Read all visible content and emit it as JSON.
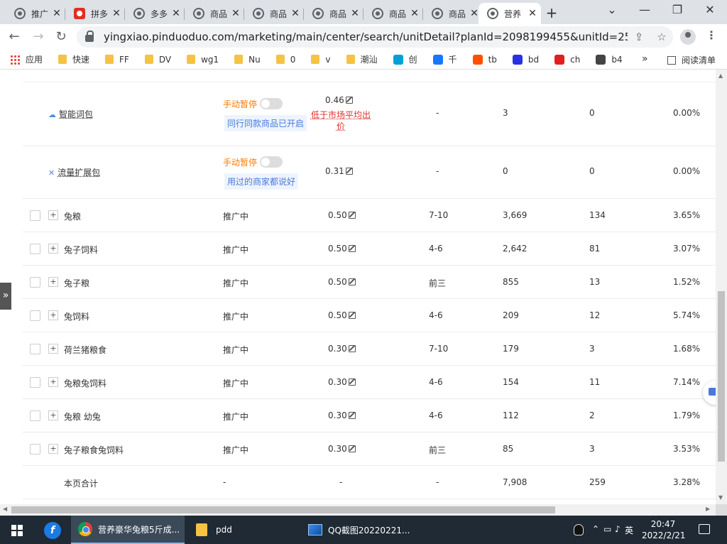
{
  "browser": {
    "tabs": [
      {
        "label": "推广",
        "type": "globe"
      },
      {
        "label": "拼多",
        "type": "pdd"
      },
      {
        "label": "多多",
        "type": "globe"
      },
      {
        "label": "商品",
        "type": "globe"
      },
      {
        "label": "商品",
        "type": "globe"
      },
      {
        "label": "商品",
        "type": "globe"
      },
      {
        "label": "商品",
        "type": "globe"
      },
      {
        "label": "商品",
        "type": "globe"
      },
      {
        "label": "营养",
        "type": "globe",
        "active": true
      }
    ],
    "url": "yingxiao.pinduoduo.com/marketing/main/center/search/unitDetail?planId=2098199455&unitId=257494901...",
    "bookmarks": [
      {
        "label": "应用",
        "icon": "apps-grid-icon"
      },
      {
        "label": "快速",
        "icon": "folder-icon"
      },
      {
        "label": "FF",
        "icon": "folder-icon"
      },
      {
        "label": "DV",
        "icon": "folder-icon"
      },
      {
        "label": "wg1",
        "icon": "folder-icon"
      },
      {
        "label": "Nu",
        "icon": "folder-icon"
      },
      {
        "label": "0",
        "icon": "folder-icon"
      },
      {
        "label": "v",
        "icon": "folder-icon"
      },
      {
        "label": "潮汕",
        "icon": "folder-icon"
      },
      {
        "label": "创",
        "icon": "bilibili-icon",
        "color": "#00a1d6"
      },
      {
        "label": "千",
        "icon": "qianniu-icon",
        "color": "#1677ff"
      },
      {
        "label": "tb",
        "icon": "taobao-icon",
        "color": "#ff5000"
      },
      {
        "label": "bd",
        "icon": "baidu-icon",
        "color": "#2932e1"
      },
      {
        "label": "ch",
        "icon": "ch-icon",
        "color": "#e02020"
      },
      {
        "label": "b4",
        "icon": "b4-icon",
        "color": "#444"
      }
    ],
    "reading_list": "阅读清单"
  },
  "packages": [
    {
      "icon": "cloud-icon",
      "name": "智能词包",
      "status": "手动暂停",
      "tag": "同行同款商品已开启",
      "bid": "0.46",
      "warning": "低于市场平均出价",
      "rank": "-",
      "impressions": "3",
      "clicks": "0",
      "ctr": "0.00%"
    },
    {
      "icon": "expand-icon",
      "name": "流量扩展包",
      "status": "手动暂停",
      "tag": "用过的商家都说好",
      "bid": "0.31",
      "warning": "",
      "rank": "-",
      "impressions": "0",
      "clicks": "0",
      "ctr": "0.00%"
    }
  ],
  "keywords": [
    {
      "name": "兔粮",
      "status": "推广中",
      "bid": "0.50",
      "rank": "7-10",
      "impressions": "3,669",
      "clicks": "134",
      "ctr": "3.65%"
    },
    {
      "name": "兔子饲料",
      "status": "推广中",
      "bid": "0.50",
      "rank": "4-6",
      "impressions": "2,642",
      "clicks": "81",
      "ctr": "3.07%"
    },
    {
      "name": "兔子粮",
      "status": "推广中",
      "bid": "0.50",
      "rank": "前三",
      "impressions": "855",
      "clicks": "13",
      "ctr": "1.52%"
    },
    {
      "name": "兔饲料",
      "status": "推广中",
      "bid": "0.50",
      "rank": "4-6",
      "impressions": "209",
      "clicks": "12",
      "ctr": "5.74%"
    },
    {
      "name": "荷兰猪粮食",
      "status": "推广中",
      "bid": "0.30",
      "rank": "7-10",
      "impressions": "179",
      "clicks": "3",
      "ctr": "1.68%"
    },
    {
      "name": "兔粮兔饲料",
      "status": "推广中",
      "bid": "0.30",
      "rank": "4-6",
      "impressions": "154",
      "clicks": "11",
      "ctr": "7.14%"
    },
    {
      "name": "兔粮 幼兔",
      "status": "推广中",
      "bid": "0.30",
      "rank": "4-6",
      "impressions": "112",
      "clicks": "2",
      "ctr": "1.79%"
    },
    {
      "name": "兔子粮食兔饲料",
      "status": "推广中",
      "bid": "0.30",
      "rank": "前三",
      "impressions": "85",
      "clicks": "3",
      "ctr": "3.53%"
    }
  ],
  "summary": {
    "label": "本页合计",
    "status": "-",
    "bid": "-",
    "rank": "-",
    "impressions": "7,908",
    "clicks": "259",
    "ctr": "3.28%"
  },
  "taskbar": {
    "chrome_window": "营养豪华兔粮5斤成...",
    "folder_window": "pdd",
    "screenshot_window": "QQ截图20220221...",
    "ime": "英",
    "time": "20:47",
    "date": "2022/2/21"
  }
}
